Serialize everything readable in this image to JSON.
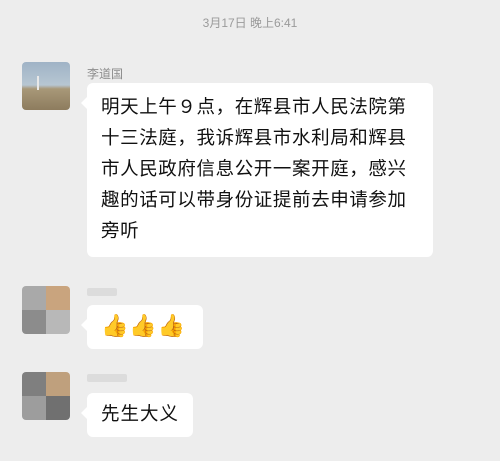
{
  "chat": {
    "timestamp": "3月17日 晚上6:41",
    "messages": [
      {
        "sender": "李道国",
        "text": "明天上午９点，在辉县市人民法院第十三法庭，我诉辉县市水利局和辉县市人民政府信息公开一案开庭，感兴趣的话可以带身份证提前去申请参加旁听"
      },
      {
        "sender": "",
        "emojis": [
          "👍",
          "👍",
          "👍"
        ]
      },
      {
        "sender": "",
        "text": "先生大义"
      }
    ]
  },
  "colors": {
    "background": "#ededed",
    "bubble": "#ffffff",
    "timestamp_text": "#9a9a9a",
    "sender_text": "#8c8c8c"
  },
  "icons": {
    "avatar_1": "landscape-avatar",
    "avatar_2": "mosaic-avatar",
    "avatar_3": "mosaic-avatar",
    "reaction": "thumbs-up-icon"
  }
}
